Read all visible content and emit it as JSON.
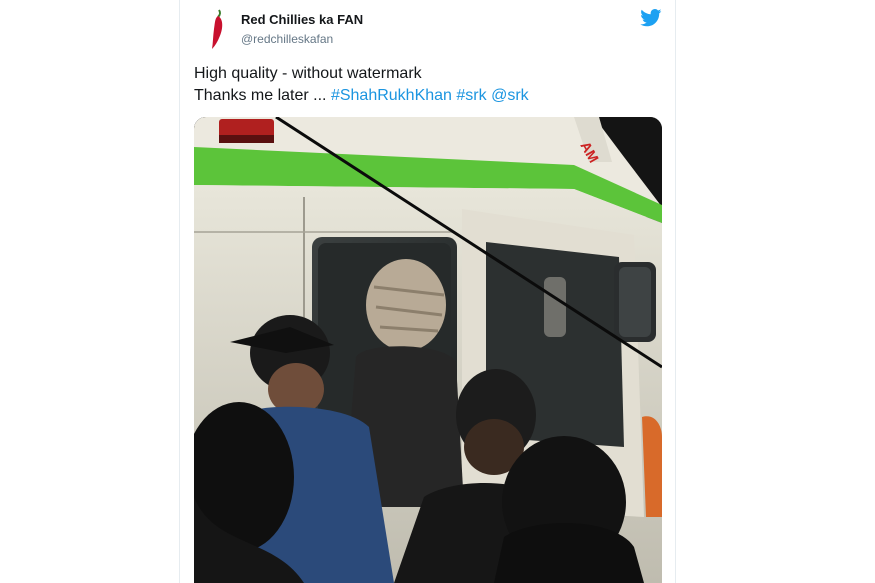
{
  "tweet": {
    "author_name": "Red Chillies ka FAN",
    "author_handle": "@redchilleskafan",
    "text_line1": "High quality - without watermark",
    "text_line2_prefix": "Thanks me later ...",
    "hashtags": [
      "#ShahRukhKhan",
      "#srk"
    ],
    "mention": "@srk",
    "media_icon": "photo-ambulance-scene"
  },
  "icons": {
    "avatar": "red-chilli-icon",
    "platform": "twitter-bird-icon"
  },
  "colors": {
    "link": "#1b95e0",
    "twitter_blue": "#1da1f2",
    "text": "#14171a",
    "secondary": "#657786",
    "chilli_red": "#c8102e",
    "ambulance_stripe": "#5cc43a"
  }
}
